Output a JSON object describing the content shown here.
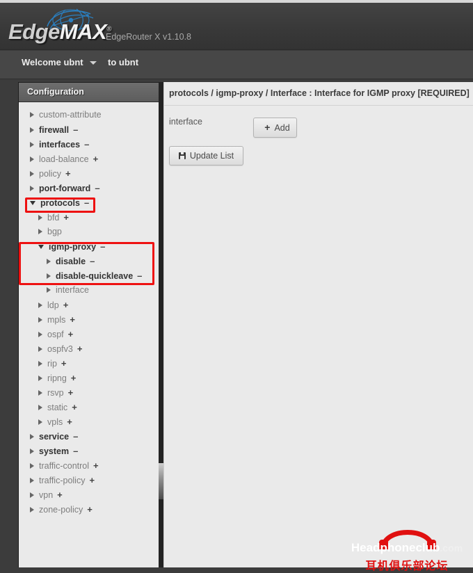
{
  "header": {
    "logo_edge": "Edge",
    "logo_max": "MAX",
    "logo_reg": "®",
    "version": "EdgeRouter X v1.10.8"
  },
  "nav": {
    "welcome": "Welcome ubnt",
    "to_label": "to ubnt"
  },
  "sidebar": {
    "title": "Configuration",
    "items": [
      {
        "label": "custom-attribute",
        "depth": 1,
        "state": "closed",
        "sign": "",
        "configured": false
      },
      {
        "label": "firewall",
        "depth": 1,
        "state": "closed",
        "sign": "–",
        "configured": true
      },
      {
        "label": "interfaces",
        "depth": 1,
        "state": "closed",
        "sign": "–",
        "configured": true
      },
      {
        "label": "load-balance",
        "depth": 1,
        "state": "closed",
        "sign": "+",
        "configured": false
      },
      {
        "label": "policy",
        "depth": 1,
        "state": "closed",
        "sign": "+",
        "configured": false
      },
      {
        "label": "port-forward",
        "depth": 1,
        "state": "closed",
        "sign": "–",
        "configured": true
      },
      {
        "label": "protocols",
        "depth": 1,
        "state": "open",
        "sign": "–",
        "configured": true
      },
      {
        "label": "bfd",
        "depth": 2,
        "state": "closed",
        "sign": "+",
        "configured": false
      },
      {
        "label": "bgp",
        "depth": 2,
        "state": "closed",
        "sign": "",
        "configured": false
      },
      {
        "label": "igmp-proxy",
        "depth": 2,
        "state": "open",
        "sign": "–",
        "configured": true
      },
      {
        "label": "disable",
        "depth": 3,
        "state": "closed",
        "sign": "–",
        "configured": true
      },
      {
        "label": "disable-quickleave",
        "depth": 3,
        "state": "closed",
        "sign": "–",
        "configured": true
      },
      {
        "label": "interface",
        "depth": 3,
        "state": "closed",
        "sign": "",
        "configured": false
      },
      {
        "label": "ldp",
        "depth": 2,
        "state": "closed",
        "sign": "+",
        "configured": false
      },
      {
        "label": "mpls",
        "depth": 2,
        "state": "closed",
        "sign": "+",
        "configured": false
      },
      {
        "label": "ospf",
        "depth": 2,
        "state": "closed",
        "sign": "+",
        "configured": false
      },
      {
        "label": "ospfv3",
        "depth": 2,
        "state": "closed",
        "sign": "+",
        "configured": false
      },
      {
        "label": "rip",
        "depth": 2,
        "state": "closed",
        "sign": "+",
        "configured": false
      },
      {
        "label": "ripng",
        "depth": 2,
        "state": "closed",
        "sign": "+",
        "configured": false
      },
      {
        "label": "rsvp",
        "depth": 2,
        "state": "closed",
        "sign": "+",
        "configured": false
      },
      {
        "label": "static",
        "depth": 2,
        "state": "closed",
        "sign": "+",
        "configured": false
      },
      {
        "label": "vpls",
        "depth": 2,
        "state": "closed",
        "sign": "+",
        "configured": false
      },
      {
        "label": "service",
        "depth": 1,
        "state": "closed",
        "sign": "–",
        "configured": true
      },
      {
        "label": "system",
        "depth": 1,
        "state": "closed",
        "sign": "–",
        "configured": true
      },
      {
        "label": "traffic-control",
        "depth": 1,
        "state": "closed",
        "sign": "+",
        "configured": false
      },
      {
        "label": "traffic-policy",
        "depth": 1,
        "state": "closed",
        "sign": "+",
        "configured": false
      },
      {
        "label": "vpn",
        "depth": 1,
        "state": "closed",
        "sign": "+",
        "configured": false
      },
      {
        "label": "zone-policy",
        "depth": 1,
        "state": "closed",
        "sign": "+",
        "configured": false
      }
    ]
  },
  "content": {
    "breadcrumb": "protocols / igmp-proxy / Interface : Interface for IGMP proxy [REQUIRED]",
    "field_label": "interface",
    "add_button": "Add",
    "add_plus": "+",
    "update_button": "Update List"
  },
  "watermark": {
    "brand": "Headphoneclub",
    "tld": ".com",
    "chinese": "耳机俱乐部论坛"
  },
  "colors": {
    "accent_red": "#ee1111",
    "logo_blue": "#2a7fc0",
    "panel_bg": "#eaeaea",
    "header_bg": "#3c3c3c"
  }
}
